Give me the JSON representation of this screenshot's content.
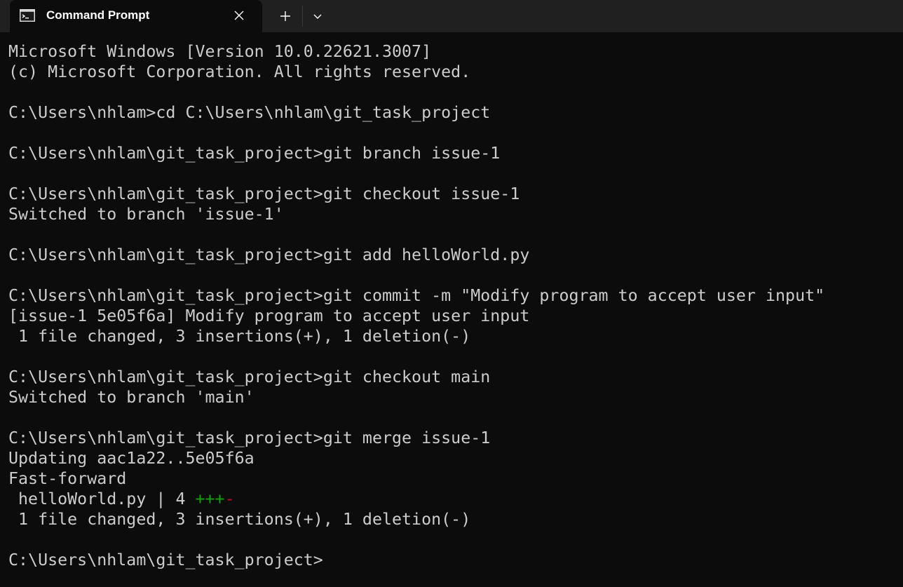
{
  "window": {
    "tab_title": "Command Prompt",
    "tab_icon": "cmd-icon",
    "close_icon": "close-icon",
    "new_tab_icon": "plus-icon",
    "dropdown_icon": "chevron-down-icon"
  },
  "terminal": {
    "lines": [
      "Microsoft Windows [Version 10.0.22621.3007]",
      "(c) Microsoft Corporation. All rights reserved.",
      "",
      "C:\\Users\\nhlam>cd C:\\Users\\nhlam\\git_task_project",
      "",
      "C:\\Users\\nhlam\\git_task_project>git branch issue-1",
      "",
      "C:\\Users\\nhlam\\git_task_project>git checkout issue-1",
      "Switched to branch 'issue-1'",
      "",
      "C:\\Users\\nhlam\\git_task_project>git add helloWorld.py",
      "",
      "C:\\Users\\nhlam\\git_task_project>git commit -m \"Modify program to accept user input\"",
      "[issue-1 5e05f6a] Modify program to accept user input",
      " 1 file changed, 3 insertions(+), 1 deletion(-)",
      "",
      "C:\\Users\\nhlam\\git_task_project>git checkout main",
      "Switched to branch 'main'",
      "",
      "C:\\Users\\nhlam\\git_task_project>git merge issue-1",
      "Updating aac1a22..5e05f6a",
      "Fast-forward"
    ],
    "diffstat": {
      "text": " helloWorld.py | 4 ",
      "plus": "+++",
      "minus": "-"
    },
    "lines_after": [
      " 1 file changed, 3 insertions(+), 1 deletion(-)",
      "",
      "C:\\Users\\nhlam\\git_task_project>"
    ],
    "colors": {
      "background": "#0c0c0c",
      "foreground": "#cccccc",
      "insertion": "#13a10e",
      "deletion": "#c50f1f"
    }
  }
}
